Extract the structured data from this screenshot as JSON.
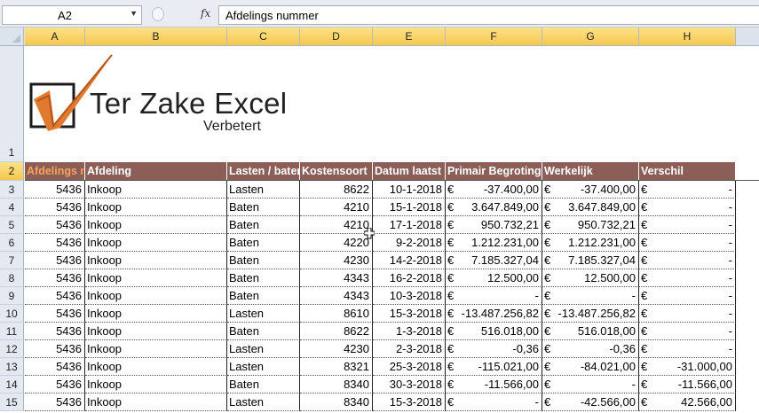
{
  "formula_bar": {
    "name_box": "A2",
    "fx": "fx",
    "value": "Afdelings nummer"
  },
  "columns": [
    "A",
    "B",
    "C",
    "D",
    "E",
    "F",
    "G",
    "H"
  ],
  "logo": {
    "title": "Ter Zake Excel",
    "subtitle": "Verbetert",
    "colors": {
      "check": "#e07a2e",
      "box": "#1a1a1a"
    }
  },
  "header_row": {
    "row_number": "2",
    "cells": [
      "Afdelings nummer",
      "Afdeling",
      "Lasten / baten",
      "Kostensoort",
      "Datum laatst",
      "Primair Begroting",
      "Werkelijk",
      "Verschil"
    ]
  },
  "currency": "€",
  "rows": [
    {
      "n": "3",
      "a": "5436",
      "b": "Inkoop",
      "c": "Lasten",
      "d": "8622",
      "e": "10-1-2018",
      "f": "-37.400,00",
      "g": "-37.400,00",
      "h": "-"
    },
    {
      "n": "4",
      "a": "5436",
      "b": "Inkoop",
      "c": "Baten",
      "d": "4210",
      "e": "15-1-2018",
      "f": "3.647.849,00",
      "g": "3.647.849,00",
      "h": "-"
    },
    {
      "n": "5",
      "a": "5436",
      "b": "Inkoop",
      "c": "Baten",
      "d": "4210",
      "e": "17-1-2018",
      "f": "950.732,21",
      "g": "950.732,21",
      "h": "-"
    },
    {
      "n": "6",
      "a": "5436",
      "b": "Inkoop",
      "c": "Baten",
      "d": "4220",
      "e": "9-2-2018",
      "f": "1.212.231,00",
      "g": "1.212.231,00",
      "h": "-"
    },
    {
      "n": "7",
      "a": "5436",
      "b": "Inkoop",
      "c": "Baten",
      "d": "4230",
      "e": "14-2-2018",
      "f": "7.185.327,04",
      "g": "7.185.327,04",
      "h": "-"
    },
    {
      "n": "8",
      "a": "5436",
      "b": "Inkoop",
      "c": "Baten",
      "d": "4343",
      "e": "16-2-2018",
      "f": "12.500,00",
      "g": "12.500,00",
      "h": "-"
    },
    {
      "n": "9",
      "a": "5436",
      "b": "Inkoop",
      "c": "Baten",
      "d": "4343",
      "e": "10-3-2018",
      "f": "-",
      "g": "-",
      "h": "-"
    },
    {
      "n": "10",
      "a": "5436",
      "b": "Inkoop",
      "c": "Lasten",
      "d": "8610",
      "e": "15-3-2018",
      "f": "-13.487.256,82",
      "g": "-13.487.256,82",
      "h": "-"
    },
    {
      "n": "11",
      "a": "5436",
      "b": "Inkoop",
      "c": "Baten",
      "d": "8622",
      "e": "1-3-2018",
      "f": "516.018,00",
      "g": "516.018,00",
      "h": "-"
    },
    {
      "n": "12",
      "a": "5436",
      "b": "Inkoop",
      "c": "Lasten",
      "d": "4230",
      "e": "2-3-2018",
      "f": "-0,36",
      "g": "-0,36",
      "h": "-"
    },
    {
      "n": "13",
      "a": "5436",
      "b": "Inkoop",
      "c": "Lasten",
      "d": "8321",
      "e": "25-3-2018",
      "f": "-115.021,00",
      "g": "-84.021,00",
      "h": "-31.000,00"
    },
    {
      "n": "14",
      "a": "5436",
      "b": "Inkoop",
      "c": "Baten",
      "d": "8340",
      "e": "30-3-2018",
      "f": "-11.566,00",
      "g": "-",
      "h": "-11.566,00"
    },
    {
      "n": "15",
      "a": "5436",
      "b": "Inkoop",
      "c": "Lasten",
      "d": "8340",
      "e": "15-3-2018",
      "f": "-",
      "g": "-42.566,00",
      "h": "42.566,00"
    }
  ]
}
